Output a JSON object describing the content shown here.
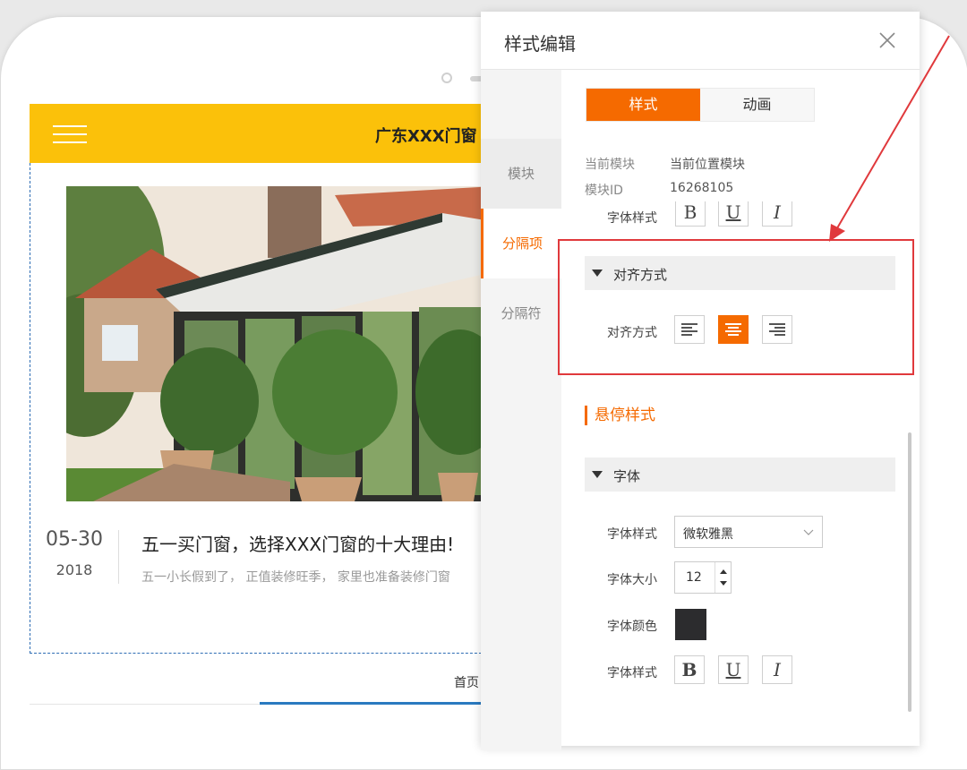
{
  "preview": {
    "site_title": "广东XXX门窗",
    "news": {
      "date_day": "05-30",
      "date_year": "2018",
      "title": "五一买门窗，选择XXX门窗的十大理由!",
      "summary": "五一小长假到了， 正值装修旺季， 家里也准备装修门窗"
    },
    "nav": {
      "home": "首页"
    }
  },
  "panel": {
    "title": "样式编辑",
    "tabs": [
      "样式",
      "动画"
    ],
    "active_tab": "样式",
    "side_tabs": [
      "模块",
      "分隔项",
      "分隔符"
    ],
    "active_side_tab": "分隔项",
    "current_module_label": "当前模块",
    "current_module_value": "当前位置模块",
    "module_id_label": "模块ID",
    "module_id_value": "16268105",
    "partial_font_style_label": "字体样式",
    "align_section": {
      "title": "对齐方式",
      "label": "对齐方式",
      "options": [
        "align-left-icon",
        "align-center-icon",
        "align-right-icon"
      ],
      "selected": "align-center-icon"
    },
    "hover_heading": "悬停样式",
    "font_section": {
      "title": "字体",
      "font_style_label": "字体样式",
      "font_family_value": "微软雅黑",
      "font_size_label": "字体大小",
      "font_size_value": "12",
      "font_color_label": "字体颜色",
      "font_color_value": "#2c2c2e",
      "font_deco_label": "字体样式",
      "bold_label": "B",
      "underline_label": "U",
      "italic_label": "I"
    }
  },
  "colors": {
    "accent": "#f56a00",
    "header_yellow": "#fbc10a",
    "highlight_red": "#e0393c",
    "nav_underline": "#2a7ac0"
  }
}
